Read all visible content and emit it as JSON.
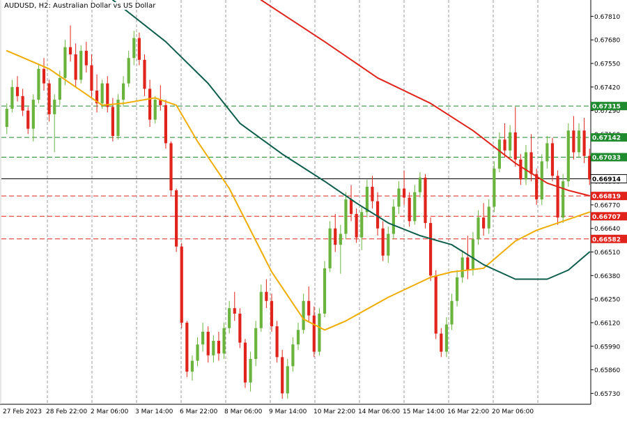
{
  "chart_data": {
    "type": "candlestick",
    "title": "AUDUSD, H2:  Australian Dollar vs US Dollar",
    "ylim": [
      0.6567,
      0.679
    ],
    "y_ticks": [
      0.6781,
      0.6768,
      0.6755,
      0.6742,
      0.6729,
      0.6716,
      0.6703,
      0.669,
      0.6677,
      0.6664,
      0.6651,
      0.6638,
      0.6625,
      0.6612,
      0.6599,
      0.6586,
      0.6573
    ],
    "y_tick_labels": [
      "0.67810",
      "0.67680",
      "0.67550",
      "0.67420",
      "0.67290",
      "0.67160",
      "0.67030",
      "0.66900",
      "0.66770",
      "0.66640",
      "0.66510",
      "0.66380",
      "0.66250",
      "0.66120",
      "0.65990",
      "0.65860",
      "0.65730"
    ],
    "x_labels": [
      "27 Feb 2023",
      "28 Feb 22:00",
      "2 Mar 06:00",
      "3 Mar 14:00",
      "6 Mar 22:00",
      "8 Mar 06:00",
      "9 Mar 14:00",
      "10 Mar 22:00",
      "14 Mar 06:00",
      "15 Mar 14:00",
      "16 Mar 22:00",
      "20 Mar 06:00"
    ],
    "grid": true,
    "current_price": {
      "value": 0.66914,
      "label": "0.66914"
    },
    "levels": [
      {
        "value": 0.67315,
        "label": "0.67315",
        "type": "resistance",
        "color": "#1f8a2e"
      },
      {
        "value": 0.67142,
        "label": "0.67142",
        "type": "resistance",
        "color": "#1f8a2e"
      },
      {
        "value": 0.67033,
        "label": "0.67033",
        "type": "resistance",
        "color": "#1f8a2e"
      },
      {
        "value": 0.66819,
        "label": "0.66819",
        "type": "support",
        "color": "#e0241b"
      },
      {
        "value": 0.66707,
        "label": "0.66707",
        "type": "support",
        "color": "#e0241b"
      },
      {
        "value": 0.66582,
        "label": "0.66582",
        "type": "support",
        "color": "#e0241b"
      }
    ],
    "ohlc_compact": [
      [
        0.672,
        0.6733,
        0.6716,
        0.673
      ],
      [
        0.673,
        0.6746,
        0.6728,
        0.6742
      ],
      [
        0.6742,
        0.6748,
        0.6734,
        0.6737
      ],
      [
        0.6737,
        0.6741,
        0.6726,
        0.6729
      ],
      [
        0.6729,
        0.6731,
        0.6716,
        0.6719
      ],
      [
        0.6719,
        0.6738,
        0.6712,
        0.6735
      ],
      [
        0.6735,
        0.6755,
        0.6733,
        0.6752
      ],
      [
        0.6752,
        0.6758,
        0.674,
        0.6744
      ],
      [
        0.6744,
        0.6746,
        0.6723,
        0.6727
      ],
      [
        0.6727,
        0.6738,
        0.6706,
        0.6735
      ],
      [
        0.6735,
        0.6751,
        0.6732,
        0.6747
      ],
      [
        0.6747,
        0.6768,
        0.6743,
        0.6764
      ],
      [
        0.6764,
        0.6776,
        0.6756,
        0.676
      ],
      [
        0.676,
        0.6766,
        0.6742,
        0.6746
      ],
      [
        0.6746,
        0.6765,
        0.6744,
        0.6762
      ],
      [
        0.6762,
        0.6767,
        0.675,
        0.6754
      ],
      [
        0.6754,
        0.676,
        0.6736,
        0.674
      ],
      [
        0.674,
        0.6749,
        0.6728,
        0.6733
      ],
      [
        0.6733,
        0.6746,
        0.673,
        0.6744
      ],
      [
        0.6744,
        0.6748,
        0.6728,
        0.6731
      ],
      [
        0.6731,
        0.6736,
        0.6712,
        0.6715
      ],
      [
        0.6715,
        0.6738,
        0.6713,
        0.6735
      ],
      [
        0.6735,
        0.6748,
        0.6731,
        0.6744
      ],
      [
        0.6744,
        0.6762,
        0.6742,
        0.6758
      ],
      [
        0.6758,
        0.6773,
        0.6754,
        0.6769
      ],
      [
        0.6769,
        0.6772,
        0.6754,
        0.6757
      ],
      [
        0.6757,
        0.676,
        0.6737,
        0.6741
      ],
      [
        0.6741,
        0.6746,
        0.672,
        0.6724
      ],
      [
        0.6724,
        0.6737,
        0.6722,
        0.6735
      ],
      [
        0.6735,
        0.6743,
        0.6729,
        0.6732
      ],
      [
        0.6732,
        0.6735,
        0.6708,
        0.6711
      ],
      [
        0.6711,
        0.6712,
        0.6682,
        0.6685
      ],
      [
        0.6685,
        0.6686,
        0.6651,
        0.6654
      ],
      [
        0.6654,
        0.6656,
        0.6609,
        0.6612
      ],
      [
        0.6612,
        0.6613,
        0.6582,
        0.6585
      ],
      [
        0.6585,
        0.6594,
        0.658,
        0.6591
      ],
      [
        0.6591,
        0.6604,
        0.6588,
        0.66
      ],
      [
        0.66,
        0.6612,
        0.6596,
        0.6607
      ],
      [
        0.6607,
        0.661,
        0.659,
        0.6594
      ],
      [
        0.6594,
        0.6605,
        0.659,
        0.6602
      ],
      [
        0.6602,
        0.6607,
        0.6591,
        0.6595
      ],
      [
        0.6595,
        0.6612,
        0.6592,
        0.6609
      ],
      [
        0.6609,
        0.6624,
        0.6606,
        0.662
      ],
      [
        0.662,
        0.6629,
        0.6613,
        0.6617
      ],
      [
        0.6617,
        0.662,
        0.6598,
        0.6601
      ],
      [
        0.6601,
        0.6603,
        0.6576,
        0.6579
      ],
      [
        0.6579,
        0.6596,
        0.6574,
        0.6592
      ],
      [
        0.6592,
        0.6613,
        0.6588,
        0.6609
      ],
      [
        0.6609,
        0.6633,
        0.6607,
        0.6629
      ],
      [
        0.6629,
        0.6636,
        0.662,
        0.6624
      ],
      [
        0.6624,
        0.6628,
        0.6607,
        0.661
      ],
      [
        0.661,
        0.6613,
        0.659,
        0.6593
      ],
      [
        0.6593,
        0.6597,
        0.657,
        0.6573
      ],
      [
        0.6573,
        0.6592,
        0.657,
        0.6588
      ],
      [
        0.6588,
        0.6604,
        0.6585,
        0.66
      ],
      [
        0.66,
        0.6612,
        0.6597,
        0.6608
      ],
      [
        0.6608,
        0.6628,
        0.6606,
        0.6624
      ],
      [
        0.6624,
        0.6632,
        0.6612,
        0.6616
      ],
      [
        0.6616,
        0.6621,
        0.6593,
        0.6596
      ],
      [
        0.6596,
        0.662,
        0.6594,
        0.6617
      ],
      [
        0.6617,
        0.6646,
        0.6615,
        0.6642
      ],
      [
        0.6642,
        0.6668,
        0.664,
        0.6664
      ],
      [
        0.6664,
        0.6672,
        0.6651,
        0.6655
      ],
      [
        0.6655,
        0.6666,
        0.6639,
        0.6661
      ],
      [
        0.6661,
        0.6684,
        0.6658,
        0.668
      ],
      [
        0.668,
        0.6688,
        0.6668,
        0.6672
      ],
      [
        0.6672,
        0.6675,
        0.6656,
        0.6659
      ],
      [
        0.6659,
        0.6676,
        0.6652,
        0.6673
      ],
      [
        0.6673,
        0.6691,
        0.667,
        0.6687
      ],
      [
        0.6687,
        0.6693,
        0.6675,
        0.6679
      ],
      [
        0.6679,
        0.6684,
        0.666,
        0.6664
      ],
      [
        0.6664,
        0.6668,
        0.6646,
        0.6649
      ],
      [
        0.6649,
        0.6665,
        0.6645,
        0.6661
      ],
      [
        0.6661,
        0.668,
        0.6658,
        0.6676
      ],
      [
        0.6676,
        0.669,
        0.6672,
        0.6686
      ],
      [
        0.6686,
        0.6696,
        0.6677,
        0.6681
      ],
      [
        0.6681,
        0.6684,
        0.6665,
        0.6668
      ],
      [
        0.6668,
        0.6688,
        0.6666,
        0.6684
      ],
      [
        0.6684,
        0.6695,
        0.6681,
        0.6692
      ],
      [
        0.6692,
        0.6694,
        0.6664,
        0.6667
      ],
      [
        0.6667,
        0.667,
        0.6635,
        0.6638
      ],
      [
        0.6638,
        0.6641,
        0.6603,
        0.6606
      ],
      [
        0.6606,
        0.6609,
        0.6593,
        0.6596
      ],
      [
        0.6596,
        0.6615,
        0.6593,
        0.6611
      ],
      [
        0.6611,
        0.6628,
        0.6608,
        0.6624
      ],
      [
        0.6624,
        0.6641,
        0.6621,
        0.6637
      ],
      [
        0.6637,
        0.6652,
        0.6634,
        0.6648
      ],
      [
        0.6648,
        0.666,
        0.6636,
        0.6641
      ],
      [
        0.6641,
        0.6662,
        0.6638,
        0.6658
      ],
      [
        0.6658,
        0.6674,
        0.6655,
        0.667
      ],
      [
        0.667,
        0.6678,
        0.666,
        0.6664
      ],
      [
        0.6664,
        0.668,
        0.6661,
        0.6676
      ],
      [
        0.6676,
        0.6701,
        0.6673,
        0.6697
      ],
      [
        0.6697,
        0.6717,
        0.6695,
        0.6713
      ],
      [
        0.6713,
        0.6722,
        0.6703,
        0.6707
      ],
      [
        0.6707,
        0.6721,
        0.6703,
        0.6717
      ],
      [
        0.6717,
        0.6731,
        0.6698,
        0.6702
      ],
      [
        0.6702,
        0.6705,
        0.6688,
        0.6691
      ],
      [
        0.6691,
        0.671,
        0.6688,
        0.6706
      ],
      [
        0.6706,
        0.6716,
        0.669,
        0.6694
      ],
      [
        0.6694,
        0.6697,
        0.6677,
        0.668
      ],
      [
        0.668,
        0.6705,
        0.6677,
        0.6701
      ],
      [
        0.6701,
        0.6715,
        0.6697,
        0.6711
      ],
      [
        0.6711,
        0.6714,
        0.669,
        0.6693
      ],
      [
        0.6693,
        0.6696,
        0.6666,
        0.667
      ],
      [
        0.667,
        0.6694,
        0.6667,
        0.669
      ],
      [
        0.669,
        0.6722,
        0.6687,
        0.6718
      ],
      [
        0.6718,
        0.6726,
        0.6702,
        0.6706
      ],
      [
        0.6706,
        0.6722,
        0.6703,
        0.6718
      ],
      [
        0.6718,
        0.6725,
        0.67,
        0.6704
      ],
      [
        0.6704,
        0.6708,
        0.6688,
        0.6691
      ]
    ],
    "ohlc_columns": [
      "open",
      "high",
      "low",
      "close"
    ],
    "moving_averages": [
      {
        "name": "MA fast",
        "color": "#f0ad00",
        "points": [
          [
            0,
            0.6762
          ],
          [
            8,
            0.6752
          ],
          [
            18,
            0.6732
          ],
          [
            22,
            0.6733
          ],
          [
            28,
            0.6736
          ],
          [
            32,
            0.6732
          ],
          [
            36,
            0.6712
          ],
          [
            42,
            0.6686
          ],
          [
            50,
            0.664
          ],
          [
            56,
            0.6614
          ],
          [
            60,
            0.6608
          ],
          [
            64,
            0.6613
          ],
          [
            72,
            0.6626
          ],
          [
            80,
            0.6637
          ],
          [
            84,
            0.664
          ],
          [
            90,
            0.6642
          ],
          [
            96,
            0.6657
          ],
          [
            100,
            0.6663
          ],
          [
            104,
            0.6667
          ],
          [
            110,
            0.6673
          ]
        ]
      },
      {
        "name": "MA medium",
        "color": "#0e5e4c",
        "points": [
          [
            20,
            0.679
          ],
          [
            30,
            0.6767
          ],
          [
            38,
            0.6744
          ],
          [
            44,
            0.6722
          ],
          [
            52,
            0.6705
          ],
          [
            60,
            0.669
          ],
          [
            66,
            0.6678
          ],
          [
            72,
            0.6667
          ],
          [
            78,
            0.666
          ],
          [
            84,
            0.6655
          ],
          [
            90,
            0.6644
          ],
          [
            96,
            0.6636
          ],
          [
            102,
            0.6636
          ],
          [
            106,
            0.6641
          ],
          [
            110,
            0.6651
          ]
        ]
      },
      {
        "name": "MA slow",
        "color": "#e0241b",
        "points": [
          [
            48,
            0.679
          ],
          [
            60,
            0.6767
          ],
          [
            70,
            0.6747
          ],
          [
            80,
            0.6733
          ],
          [
            88,
            0.6718
          ],
          [
            96,
            0.67
          ],
          [
            102,
            0.6689
          ],
          [
            106,
            0.6685
          ],
          [
            110,
            0.6682
          ]
        ]
      }
    ]
  },
  "colors": {
    "bull": "#6ab43e",
    "bear": "#e0241b",
    "grid": "#9a9a9a",
    "current_line": "#000000",
    "resistance": "#1f8a2e",
    "support": "#e0241b",
    "axis": "#000000"
  }
}
